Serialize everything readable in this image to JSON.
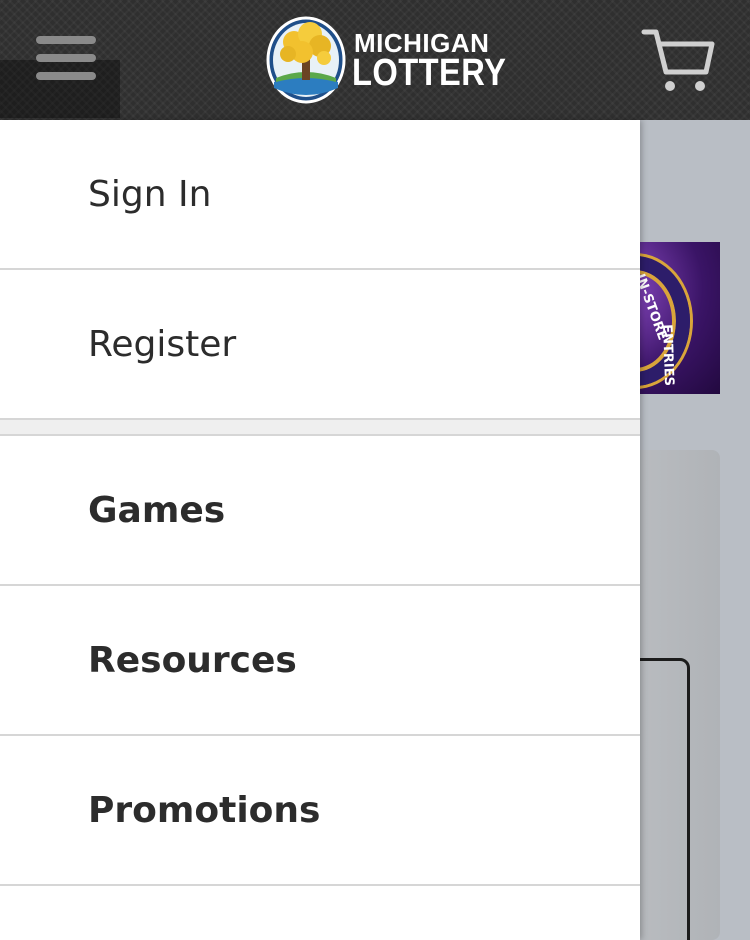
{
  "header": {
    "logo_line1": "MICHIGAN",
    "logo_line2": "LOTTERY",
    "icons": {
      "menu": "hamburger-menu-icon",
      "cart": "shopping-cart-icon"
    }
  },
  "promo": {
    "text1": "IN-STORE",
    "text2": "ENTRIES"
  },
  "drawer": {
    "account_items": [
      {
        "label": "Sign In"
      },
      {
        "label": "Register"
      }
    ],
    "nav_items": [
      {
        "label": "Games"
      },
      {
        "label": "Resources"
      },
      {
        "label": "Promotions"
      }
    ]
  },
  "colors": {
    "header_bg": "#2f2f2f",
    "drawer_bg": "#ffffff",
    "text": "#2c2c2c",
    "divider": "#d6d6d6",
    "logo_gold": "#f2c12e",
    "logo_blue": "#1f6fb0"
  }
}
